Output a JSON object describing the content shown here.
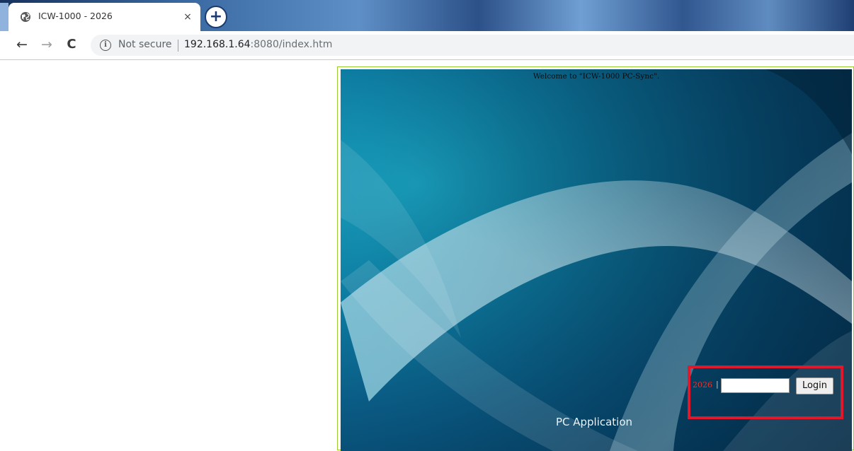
{
  "browser": {
    "tab": {
      "title": "ICW-1000 - 2026",
      "favicon": "globe-icon",
      "close_label": "×"
    },
    "new_tab_label": "+",
    "toolbar": {
      "back_icon": "arrow-left-icon",
      "forward_icon": "arrow-right-icon",
      "reload_icon": "reload-icon",
      "back_glyph": "←",
      "forward_glyph": "→",
      "reload_glyph": "C"
    },
    "address_bar": {
      "security_icon": "info-icon",
      "security_glyph": "i",
      "security_text": "Not secure",
      "url_host": "192.168.1.64",
      "url_rest": ":8080/index.htm"
    },
    "colors": {
      "tab_strip": "#3b6aa3",
      "frame_border": "#9acd32",
      "highlight": "#e0182c",
      "login_code": "#e5322d"
    }
  },
  "page": {
    "welcome_text": "Welcome to \"ICW-1000 PC-Sync\".",
    "subtitle": "PC Application",
    "login": {
      "code": "2026",
      "separator": "|",
      "password_value": "",
      "button_label": "Login"
    }
  }
}
